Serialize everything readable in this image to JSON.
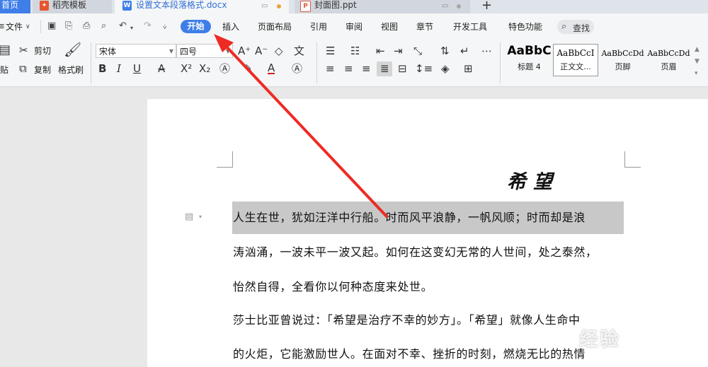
{
  "tabs": [
    {
      "label": "首页"
    },
    {
      "label": "稻壳模板"
    },
    {
      "label": "设置文本段落格式.docx"
    },
    {
      "label": "封面图.ppt"
    }
  ],
  "new_tab_symbol": "+",
  "menu": {
    "file_label": "文件",
    "items": [
      "开始",
      "插入",
      "页面布局",
      "引用",
      "审阅",
      "视图",
      "章节",
      "开发工具",
      "特色功能"
    ],
    "search_label": "查找"
  },
  "ribbon": {
    "cut_label": "剪切",
    "copy_label": "复制",
    "paste_label": "贴",
    "format_painter_label": "格式刷",
    "font_name": "宋体",
    "font_size": "四号"
  },
  "styles": [
    {
      "sample": "AaBbC",
      "name": "标题 4"
    },
    {
      "sample": "AaBbCcI",
      "name": "正文文..."
    },
    {
      "sample": "AaBbCcDd",
      "name": "页脚"
    },
    {
      "sample": "AaBbCcDd",
      "name": "页眉"
    }
  ],
  "document": {
    "title": "希望",
    "lines": [
      "人生在世，犹如汪洋中行船。时而风平浪静，一帆风顺；时而却是浪",
      "涛汹涌，一波未平一波又起。如何在这变幻无常的人世间，处之泰然，",
      "怡然自得，全看你以何种态度来处世。",
      "莎士比亚曾说过：「希望是治疗不幸的妙方」。「希望」就像人生命中",
      "的火炬，它能激励世人。在面对不幸、挫折的时刻，燃烧无比的热情"
    ]
  },
  "watermark_text": "经验",
  "colors": {
    "accent": "#3f7ee8",
    "arrow": "#ee2a24",
    "selection": "#c8c8c8"
  }
}
